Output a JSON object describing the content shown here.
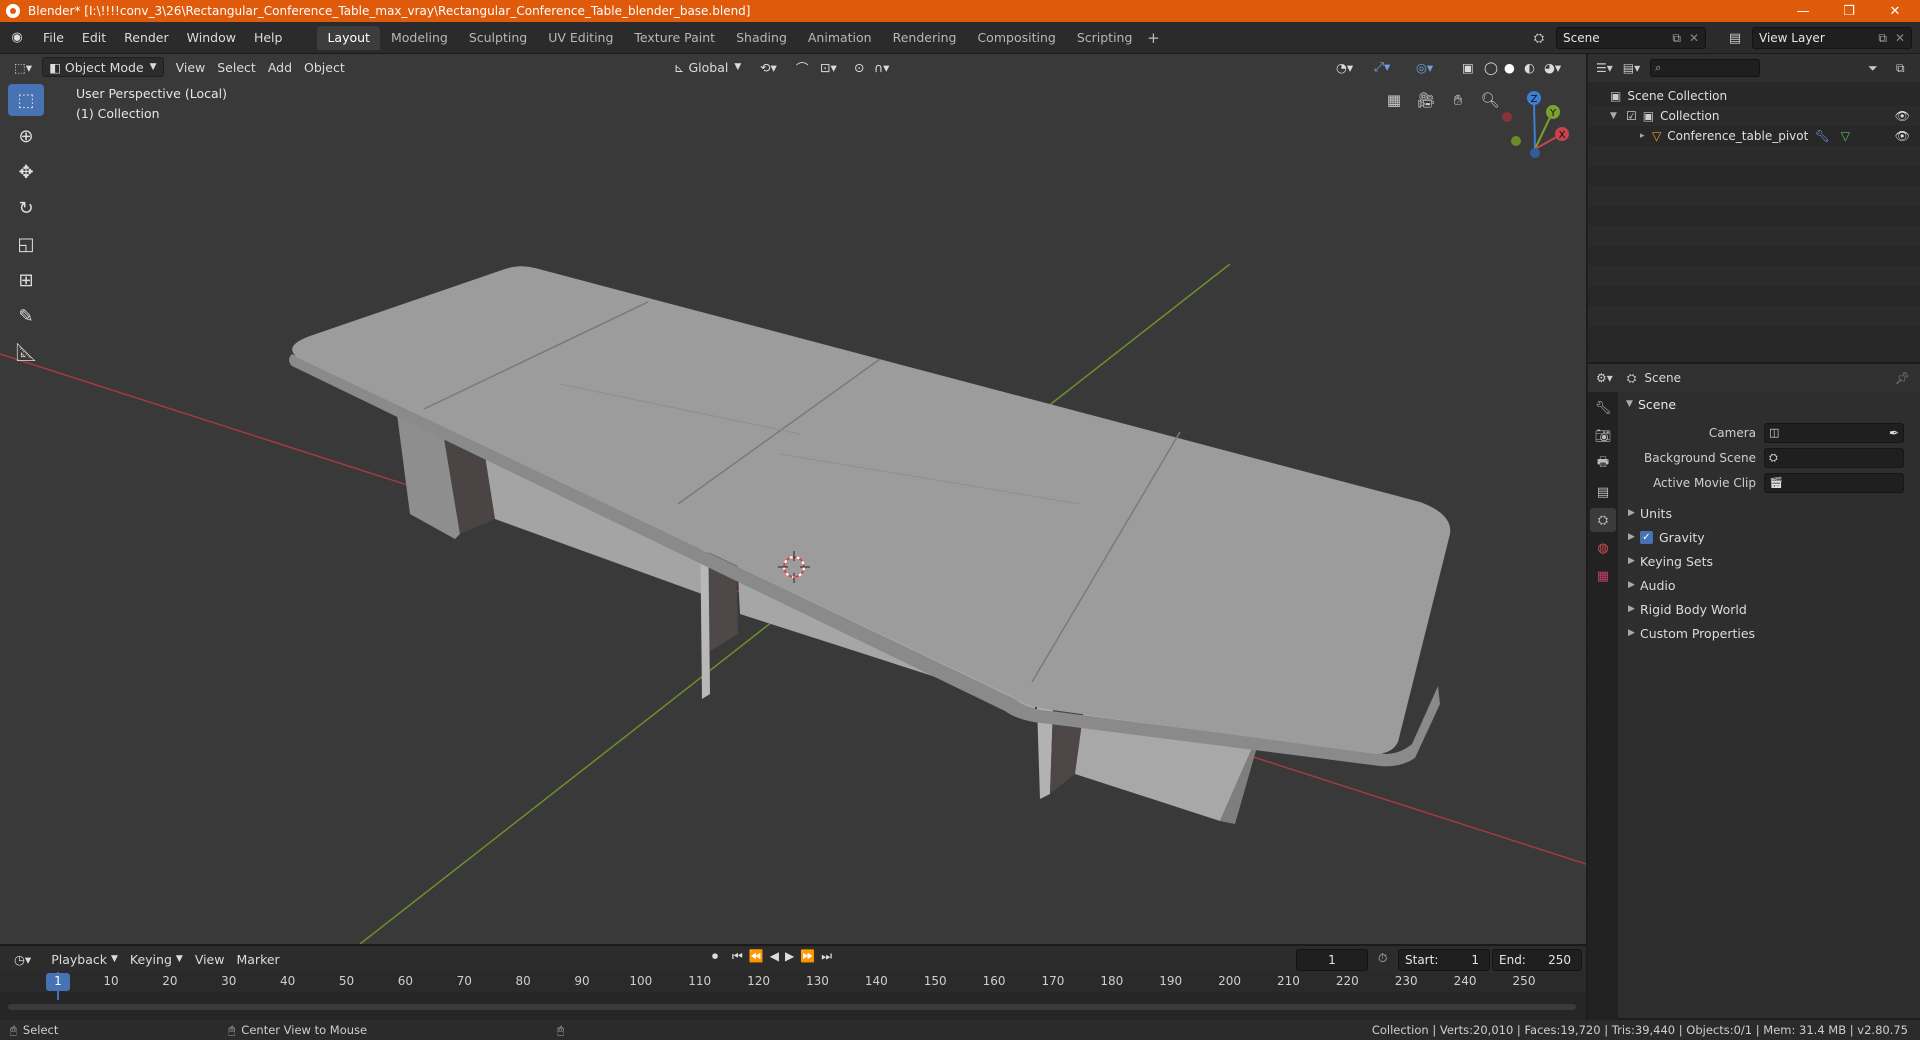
{
  "window": {
    "title": "Blender* [I:\\!!!!conv_3\\26\\Rectangular_Conference_Table_max_vray\\Rectangular_Conference_Table_blender_base.blend]",
    "controls": [
      "—",
      "❐",
      "✕"
    ]
  },
  "menu": [
    "File",
    "Edit",
    "Render",
    "Window",
    "Help"
  ],
  "workspaces": [
    {
      "label": "Layout",
      "active": true
    },
    {
      "label": "Modeling"
    },
    {
      "label": "Sculpting"
    },
    {
      "label": "UV Editing"
    },
    {
      "label": "Texture Paint"
    },
    {
      "label": "Shading"
    },
    {
      "label": "Animation"
    },
    {
      "label": "Rendering"
    },
    {
      "label": "Compositing"
    },
    {
      "label": "Scripting"
    }
  ],
  "topright": {
    "scene_name": "Scene",
    "view_layer": "View Layer"
  },
  "viewport": {
    "mode": "Object Mode",
    "menus": [
      "View",
      "Select",
      "Add",
      "Object"
    ],
    "orientation": "Global",
    "info_line1": "User Perspective (Local)",
    "info_line2": "(1) Collection",
    "gizmo": {
      "x": "X",
      "y": "Y",
      "z": "Z"
    }
  },
  "outliner": {
    "search_placeholder": "",
    "scene_collection": "Scene Collection",
    "collection": "Collection",
    "object": "Conference_table_pivot"
  },
  "properties": {
    "header": "Scene",
    "panel": "Scene",
    "rows": [
      {
        "label": "Camera"
      },
      {
        "label": "Background Scene"
      },
      {
        "label": "Active Movie Clip"
      }
    ],
    "subpanels": [
      "Units",
      "Gravity",
      "Keying Sets",
      "Audio",
      "Rigid Body World",
      "Custom Properties"
    ]
  },
  "timeline": {
    "menus": [
      "Playback",
      "Keying",
      "View",
      "Marker"
    ],
    "current_frame": "1",
    "start_label": "Start:",
    "start": "1",
    "end_label": "End:",
    "end": "250",
    "ticks": [
      "1",
      "10",
      "20",
      "30",
      "40",
      "50",
      "60",
      "70",
      "80",
      "90",
      "100",
      "110",
      "120",
      "130",
      "140",
      "150",
      "160",
      "170",
      "180",
      "190",
      "200",
      "210",
      "220",
      "230",
      "240",
      "250"
    ]
  },
  "status": {
    "select": "Select",
    "center": "Center View to Mouse",
    "stats": "Collection | Verts:20,010 | Faces:19,720 | Tris:39,440 | Objects:0/1 | Mem: 31.4 MB | v2.80.75"
  },
  "colors": {
    "accent": "#4772b3",
    "titlebar": "#e05a0c",
    "axis_x": "#c8434b",
    "axis_y": "#7da02e"
  }
}
